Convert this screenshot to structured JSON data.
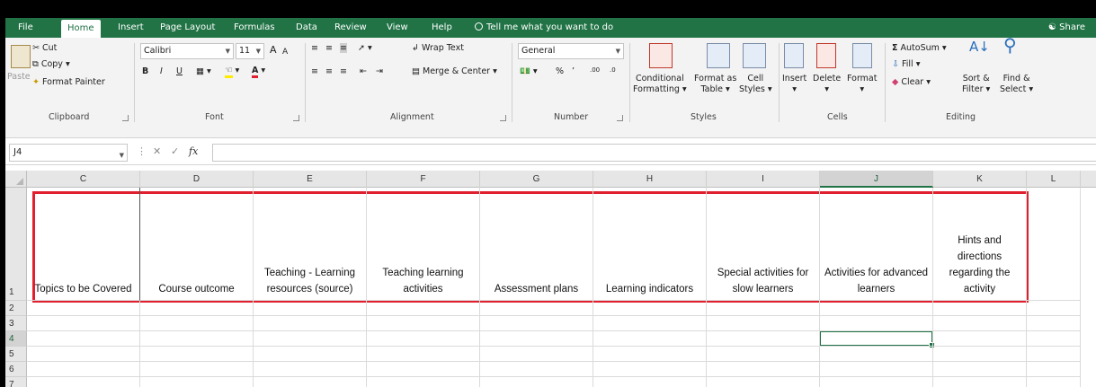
{
  "ribbon_tabs": [
    {
      "label": "File"
    },
    {
      "label": "Home"
    },
    {
      "label": "Insert"
    },
    {
      "label": "Page Layout"
    },
    {
      "label": "Formulas"
    },
    {
      "label": "Data"
    },
    {
      "label": "Review"
    },
    {
      "label": "View"
    },
    {
      "label": "Help"
    }
  ],
  "tell_me": "Tell me what you want to do",
  "share": "Share",
  "clipboard": {
    "paste": "Paste",
    "cut": "Cut",
    "copy": "Copy",
    "format_painter": "Format Painter",
    "group": "Clipboard"
  },
  "font": {
    "name": "Calibri",
    "size": "11",
    "bold": "B",
    "italic": "I",
    "underline": "U",
    "grow": "A",
    "shrink": "A",
    "color": "A",
    "group": "Font"
  },
  "alignment": {
    "wrap": "Wrap Text",
    "merge": "Merge & Center",
    "group": "Alignment"
  },
  "number": {
    "format": "General",
    "percent": "%",
    "comma": "’",
    "group": "Number",
    "inc": ".00",
    "dec": ".0"
  },
  "styles": {
    "conditional_1": "Conditional",
    "conditional_2": "Formatting",
    "format_table_1": "Format as",
    "format_table_2": "Table",
    "cell_styles_1": "Cell",
    "cell_styles_2": "Styles",
    "group": "Styles"
  },
  "cells": {
    "insert": "Insert",
    "delete": "Delete",
    "format": "Format",
    "group": "Cells"
  },
  "editing": {
    "autosum": "AutoSum",
    "fill": "Fill",
    "clear": "Clear",
    "sort_1": "Sort &",
    "sort_2": "Filter",
    "find_1": "Find &",
    "find_2": "Select",
    "group": "Editing"
  },
  "formula_bar": {
    "name_box": "J4",
    "fx": "fx",
    "value": ""
  },
  "columns": [
    "C",
    "D",
    "E",
    "F",
    "G",
    "H",
    "I",
    "J",
    "K",
    "L"
  ],
  "rows": [
    "1",
    "2",
    "3",
    "4",
    "5",
    "6",
    "7"
  ],
  "selected_cell": "J4",
  "headers": [
    "Topics to be Covered",
    "Course outcome",
    "Teaching - Learning resources (source)",
    "Teaching learning activities",
    "Assessment plans",
    "Learning indicators",
    "Special activities for slow learners",
    "Activities for advanced learners",
    "Hints and directions regarding the activity",
    ""
  ],
  "colors": {
    "excel_green": "#217346",
    "highlight_red": "#e0202e"
  }
}
